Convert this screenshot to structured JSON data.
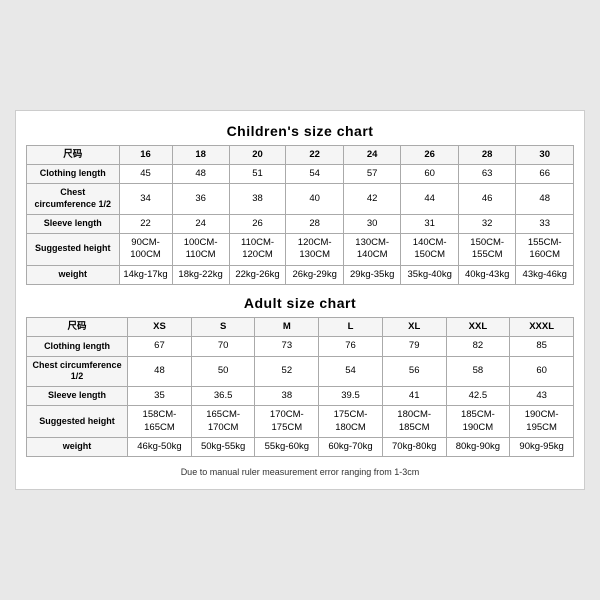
{
  "children": {
    "title": "Children's size chart",
    "headers": [
      "尺码",
      "16",
      "18",
      "20",
      "22",
      "24",
      "26",
      "28",
      "30"
    ],
    "rows": [
      {
        "label": "Clothing length",
        "values": [
          "45",
          "48",
          "51",
          "54",
          "57",
          "60",
          "63",
          "66"
        ]
      },
      {
        "label": "Chest circumference 1/2",
        "values": [
          "34",
          "36",
          "38",
          "40",
          "42",
          "44",
          "46",
          "48"
        ]
      },
      {
        "label": "Sleeve length",
        "values": [
          "22",
          "24",
          "26",
          "28",
          "30",
          "31",
          "32",
          "33"
        ]
      },
      {
        "label": "Suggested height",
        "values": [
          "90CM-100CM",
          "100CM-110CM",
          "110CM-120CM",
          "120CM-130CM",
          "130CM-140CM",
          "140CM-150CM",
          "150CM-155CM",
          "155CM-160CM"
        ]
      },
      {
        "label": "weight",
        "values": [
          "14kg-17kg",
          "18kg-22kg",
          "22kg-26kg",
          "26kg-29kg",
          "29kg-35kg",
          "35kg-40kg",
          "40kg-43kg",
          "43kg-46kg"
        ]
      }
    ]
  },
  "adult": {
    "title": "Adult size chart",
    "headers": [
      "尺码",
      "XS",
      "S",
      "M",
      "L",
      "XL",
      "XXL",
      "XXXL"
    ],
    "rows": [
      {
        "label": "Clothing length",
        "values": [
          "67",
          "70",
          "73",
          "76",
          "79",
          "82",
          "85"
        ]
      },
      {
        "label": "Chest circumference 1/2",
        "values": [
          "48",
          "50",
          "52",
          "54",
          "56",
          "58",
          "60"
        ]
      },
      {
        "label": "Sleeve length",
        "values": [
          "35",
          "36.5",
          "38",
          "39.5",
          "41",
          "42.5",
          "43"
        ]
      },
      {
        "label": "Suggested height",
        "values": [
          "158CM-165CM",
          "165CM-170CM",
          "170CM-175CM",
          "175CM-180CM",
          "180CM-185CM",
          "185CM-190CM",
          "190CM-195CM"
        ]
      },
      {
        "label": "weight",
        "values": [
          "46kg-50kg",
          "50kg-55kg",
          "55kg-60kg",
          "60kg-70kg",
          "70kg-80kg",
          "80kg-90kg",
          "90kg-95kg"
        ]
      }
    ]
  },
  "footer": "Due to manual ruler measurement error ranging from 1-3cm"
}
